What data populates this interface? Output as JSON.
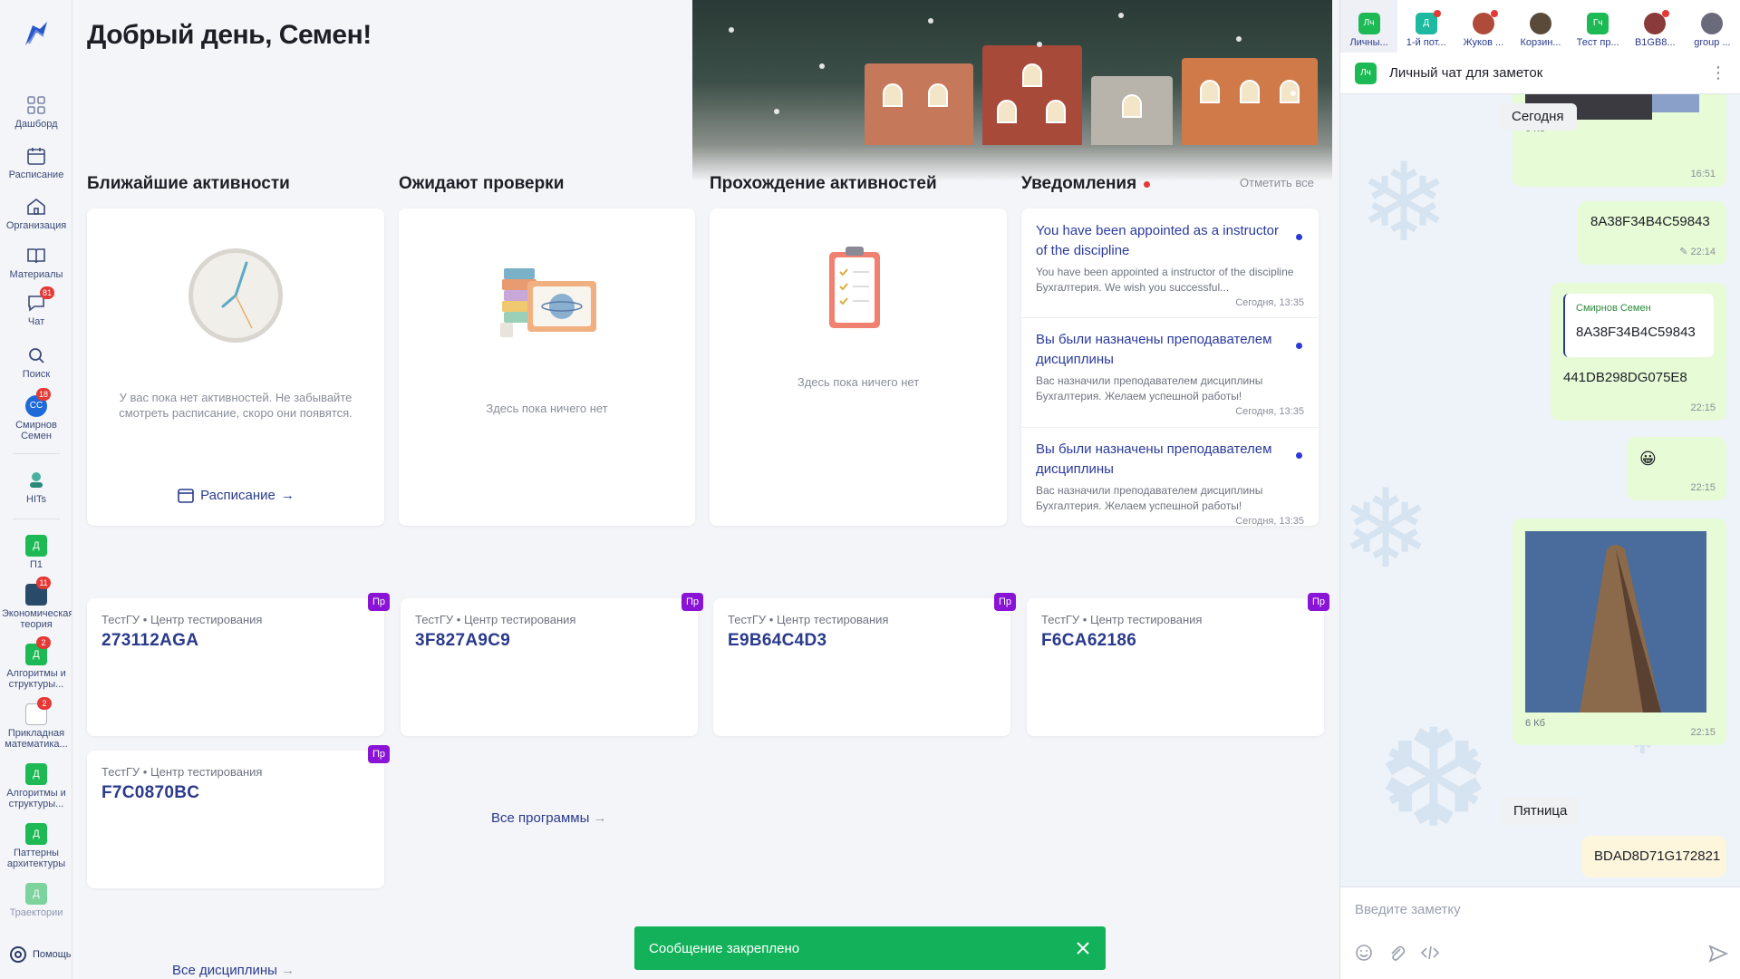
{
  "greeting": "Добрый день, Семен!",
  "rail": {
    "items": [
      {
        "label": "Дашборд",
        "icon": "dashboard-icon"
      },
      {
        "label": "Расписание",
        "icon": "calendar-icon"
      },
      {
        "label": "Организация",
        "icon": "organization-icon"
      },
      {
        "label": "Материалы",
        "icon": "book-icon"
      },
      {
        "label": "Чат",
        "icon": "chat-icon",
        "badge": "81"
      },
      {
        "label": "Поиск",
        "icon": "search-icon"
      },
      {
        "label": "Смирнов Семен",
        "avatar": "СС",
        "badge": "18"
      },
      {
        "label": "HITs",
        "icon": "hits-logo"
      },
      {
        "label": "П1",
        "square": "Д"
      },
      {
        "label": "Экономическая теория",
        "badge": "11"
      },
      {
        "label": "Алгоритмы и структуры...",
        "square": "Д",
        "badge": "2"
      },
      {
        "label": "Прикладная математика...",
        "badge": "2"
      },
      {
        "label": "Алгоритмы и структуры...",
        "square": "Д"
      },
      {
        "label": "Паттерны архитектуры",
        "square": "Д"
      },
      {
        "label": "Траектории",
        "square": "Д"
      }
    ],
    "help": "Помощь"
  },
  "sections": {
    "upcoming": "Ближайшие активности",
    "review": "Ожидают проверки",
    "progress": "Прохождение активностей",
    "notifications": "Уведомления",
    "mark_all": "Отметить все"
  },
  "cards": {
    "upcoming_empty": "У вас пока нет активностей. Не забывайте смотреть расписание, скоро они появятся.",
    "schedule_link": "Расписание",
    "review_empty": "Здесь пока ничего нет",
    "progress_empty": "Здесь пока ничего нет"
  },
  "notifications": [
    {
      "title": "You have been appointed as a instructor of the discipline",
      "body": "You have been appointed a instructor of the discipline Бухгалтерия. We wish you successful...",
      "time": "Сегодня, 13:35"
    },
    {
      "title": "Вы были назначены преподавателем дисциплины",
      "body": "Вас назначили преподавателем дисциплины Бухгалтерия. Желаем успешной работы!",
      "time": "Сегодня, 13:35"
    },
    {
      "title": "Вы были назначены преподавателем дисциплины",
      "body": "Вас назначили преподавателем дисциплины Бухгалтерия. Желаем успешной работы!",
      "time": "Сегодня, 13:35"
    }
  ],
  "programs": [
    {
      "sub": "ТестГУ • Центр тестирования",
      "code": "273112AGA",
      "badge": "Пр"
    },
    {
      "sub": "ТестГУ • Центр тестирования",
      "code": "3F827A9C9",
      "badge": "Пр"
    },
    {
      "sub": "ТестГУ • Центр тестирования",
      "code": "E9B64C4D3",
      "badge": "Пр"
    },
    {
      "sub": "ТестГУ • Центр тестирования",
      "code": "F6CA62186",
      "badge": "Пр"
    },
    {
      "sub": "ТестГУ • Центр тестирования",
      "code": "F7C0870BC",
      "badge": "Пр"
    }
  ],
  "all_programs": "Все программы",
  "all_disciplines": "Все дисциплины",
  "toast": "Сообщение закреплено",
  "chat": {
    "tabs": [
      {
        "label": "Личны...",
        "icon": "Лч",
        "color": "#1db954"
      },
      {
        "label": "1-й пот...",
        "icon": "Д",
        "color": "#1db9a0"
      },
      {
        "label": "Жуков ...",
        "icon": "",
        "color": "#b04a3a"
      },
      {
        "label": "Корзин...",
        "icon": "",
        "color": "#5a4a3a"
      },
      {
        "label": "Тест пр...",
        "icon": "Гч",
        "color": "#1db954"
      },
      {
        "label": "B1GB8...",
        "icon": "",
        "color": "#8a3a3a"
      },
      {
        "label": "group ...",
        "icon": "",
        "color": "#6a6a7a"
      }
    ],
    "title": "Личный чат для заметок",
    "title_icon": "Лч",
    "day_today": "Сегодня",
    "day_friday": "Пятница",
    "messages": [
      {
        "type": "image",
        "size": "6 Кб",
        "time": "16:51"
      },
      {
        "text": "8A38F34B4C59843",
        "time": "22:14"
      },
      {
        "reply_author": "Смирнов Семен",
        "reply_text": "8A38F34B4C59843",
        "text": "441DB298DG075E8",
        "time": "22:15"
      },
      {
        "text": "😀",
        "time": "22:15"
      },
      {
        "type": "image",
        "size": "6 Кб",
        "time": "22:15"
      },
      {
        "text": "BDAD8D71G172821"
      }
    ],
    "input_placeholder": "Введите заметку"
  }
}
